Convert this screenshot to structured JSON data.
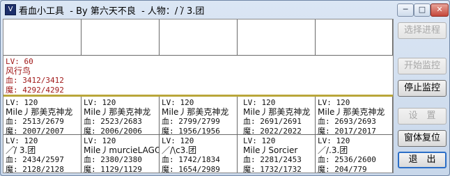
{
  "window": {
    "title": "看血小工具  - By 第六天不良  - 人物：/ /̀ 3.团",
    "icon_glyph": "V",
    "controls": {
      "minimize": "─",
      "maximize": "□",
      "close": "✕"
    }
  },
  "top_row": [
    {
      "lv": "",
      "name": "",
      "hp": "",
      "mp": ""
    },
    {
      "lv": "",
      "name": "",
      "hp": "",
      "mp": ""
    },
    {
      "lv": "",
      "name": "",
      "hp": "",
      "mp": ""
    },
    {
      "lv": "",
      "name": "",
      "hp": "",
      "mp": ""
    },
    {
      "lv": "",
      "name": "",
      "hp": "",
      "mp": ""
    }
  ],
  "target": {
    "lv": "LV: 60",
    "name": "风行鸟",
    "hp": "血: 3412/3412",
    "mp": "魔: 4292/4292"
  },
  "party_row1": [
    {
      "lv": "LV: 120",
      "name": "Mile丿那美克神龙",
      "hp": "血: 2513/2679",
      "mp": "魔: 2007/2007"
    },
    {
      "lv": "LV: 120",
      "name": "Mile丿那美克神龙",
      "hp": "血: 2523/2683",
      "mp": "魔: 2006/2006"
    },
    {
      "lv": "LV: 120",
      "name": "Mile丿那美克神龙",
      "hp": "血: 2799/2799",
      "mp": "魔: 1956/1956"
    },
    {
      "lv": "LV: 120",
      "name": "Mile丿那美克神龙",
      "hp": "血: 2691/2691",
      "mp": "魔: 2022/2022"
    },
    {
      "lv": "LV: 120",
      "name": "Mile丿那美克神龙",
      "hp": "血: 2693/2693",
      "mp": "魔: 2017/2017"
    }
  ],
  "party_row2": [
    {
      "lv": "LV: 120",
      "name": "／/̀ 3.团",
      "hp": "血: 2434/2597",
      "mp": "魔: 2128/2128"
    },
    {
      "lv": "LV: 120",
      "name": "Mile丿murcieLAGO",
      "hp": "血: 2380/2380",
      "mp": "魔: 1129/1129"
    },
    {
      "lv": "LV: 120",
      "name": "／/\\c3.团",
      "hp": "血: 1742/1834",
      "mp": "魔: 1654/2989"
    },
    {
      "lv": "LV: 120",
      "name": "Mile丿Sorcier",
      "hp": "血: 2281/2453",
      "mp": "魔: 1732/1732"
    },
    {
      "lv": "LV: 120",
      "name": "／/.3.团",
      "hp": "血: 2536/2600",
      "mp": "魔: 204/779"
    }
  ],
  "buttons": {
    "select_process": "选择进程",
    "start_monitor": "开始监控",
    "stop_monitor": "停止监控",
    "settings": "设　置",
    "reset_window": "窗体复位",
    "exit": "退　出"
  },
  "colors": {
    "target_text": "#a01818",
    "separator": "#b9a63a",
    "focus_border": "#2b6ec6"
  }
}
